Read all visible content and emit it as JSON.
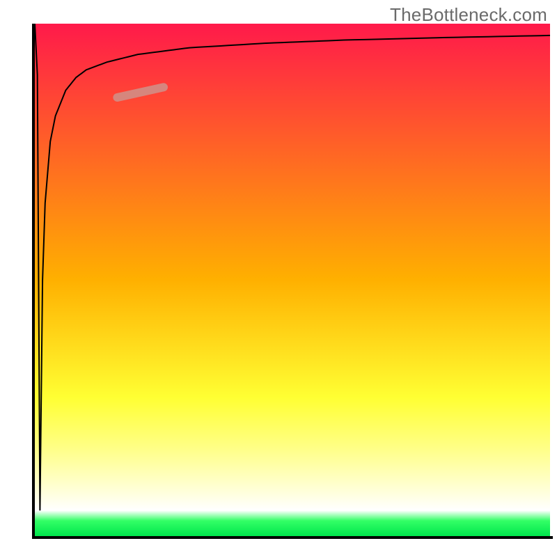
{
  "watermark": "TheBottleneck.com",
  "chart_data": {
    "type": "line",
    "title": "",
    "xlabel": "",
    "ylabel": "",
    "xlim": [
      0,
      100
    ],
    "ylim": [
      0,
      100
    ],
    "grid": false,
    "axes_visible": true,
    "axis_color": "#000000",
    "axis_thickness_left": 4,
    "axis_thickness_bottom": 4,
    "gradient_background": {
      "stops": [
        {
          "offset": 0.0,
          "color": "#ff1a4a"
        },
        {
          "offset": 0.5,
          "color": "#ffb000"
        },
        {
          "offset": 0.73,
          "color": "#ffff33"
        },
        {
          "offset": 0.83,
          "color": "#ffff88"
        },
        {
          "offset": 0.95,
          "color": "#ffffff"
        },
        {
          "offset": 0.97,
          "color": "#33ff66"
        },
        {
          "offset": 1.0,
          "color": "#00e64d"
        }
      ]
    },
    "series": [
      {
        "name": "bottleneck-curve",
        "description": "Sharp vertical dip to floor then steep logarithmic rise approaching top",
        "color": "#000000",
        "stroke_width": 2,
        "x": [
          0,
          0.5,
          1,
          1.5,
          2,
          3,
          4,
          6,
          8,
          10,
          14,
          20,
          30,
          45,
          60,
          80,
          100
        ],
        "y": [
          100,
          90,
          5,
          50,
          65,
          77,
          82,
          87,
          89.5,
          91,
          92.5,
          94,
          95.3,
          96.2,
          96.8,
          97.3,
          97.7
        ]
      }
    ],
    "highlight_segment": {
      "description": "pink highlight band on upper-left shoulder of curve",
      "color": "#d48a82",
      "stroke_width": 12,
      "x": [
        16,
        25
      ],
      "y": [
        85.6,
        87.6
      ]
    }
  }
}
